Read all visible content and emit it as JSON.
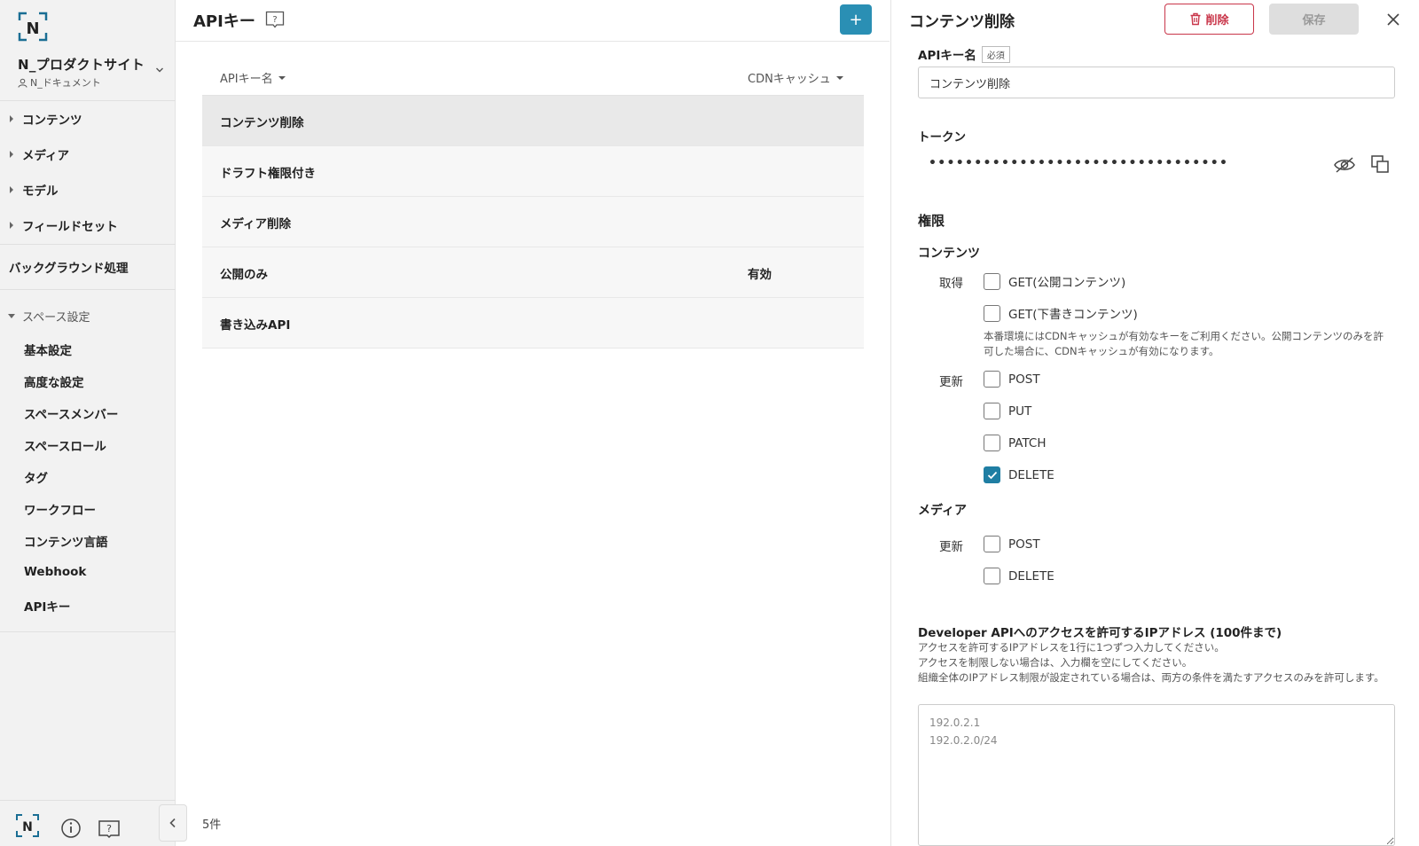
{
  "sidebar": {
    "space_name": "N_プロダクトサイト",
    "space_sub": "N_ドキュメント",
    "nav": [
      {
        "label": "コンテンツ"
      },
      {
        "label": "メディア"
      },
      {
        "label": "モデル"
      },
      {
        "label": "フィールドセット"
      }
    ],
    "background_label": "バックグラウンド処理",
    "space_settings_label": "スペース設定",
    "settings_items": [
      {
        "label": "基本設定"
      },
      {
        "label": "高度な設定"
      },
      {
        "label": "スペースメンバー"
      },
      {
        "label": "スペースロール"
      },
      {
        "label": "タグ"
      },
      {
        "label": "ワークフロー"
      },
      {
        "label": "コンテンツ言語"
      },
      {
        "label": "Webhook"
      },
      {
        "label": "APIキー"
      }
    ],
    "logo_text": "N"
  },
  "main": {
    "title": "APIキー",
    "add_label": "+",
    "columns": {
      "name": "APIキー名",
      "cdn": "CDNキャッシュ"
    },
    "rows": [
      {
        "name": "コンテンツ削除",
        "cdn": ""
      },
      {
        "name": "ドラフト権限付き",
        "cdn": ""
      },
      {
        "name": "メディア削除",
        "cdn": ""
      },
      {
        "name": "公開のみ",
        "cdn": "有効"
      },
      {
        "name": "書き込みAPI",
        "cdn": ""
      }
    ],
    "count": "5件"
  },
  "panel": {
    "title": "コンテンツ削除",
    "delete_label": "削除",
    "save_label": "保存",
    "name_label": "APIキー名",
    "required_label": "必須",
    "name_value": "コンテンツ削除",
    "token_label": "トークン",
    "token_mask": "•••••••••••••••••••••••••••••••••",
    "permissions_title": "権限",
    "content_group": "コンテンツ",
    "get_label": "取得",
    "update_label": "更新",
    "get_public": "GET(公開コンテンツ)",
    "get_draft": "GET(下書きコンテンツ)",
    "cdn_note": "本番環境にはCDNキャッシュが有効なキーをご利用ください。公開コンテンツのみを許可した場合に、CDNキャッシュが有効になります。",
    "post": "POST",
    "put": "PUT",
    "patch": "PATCH",
    "delete": "DELETE",
    "media_group": "メディア",
    "media_update_label": "更新",
    "media_post": "POST",
    "media_delete": "DELETE",
    "ip_label": "Developer APIへのアクセスを許可するIPアドレス (100件まで)",
    "ip_desc": [
      "アクセスを許可するIPアドレスを1行に1つずつ入力してください。",
      "アクセスを制限しない場合は、入力欄を空にしてください。",
      "組織全体のIPアドレス制限が設定されている場合は、両方の条件を満たすアクセスのみを許可します。"
    ],
    "ip_placeholder": "192.0.2.1\n192.0.2.0/24",
    "checked": {
      "get_public": false,
      "get_draft": false,
      "post": false,
      "put": false,
      "patch": false,
      "delete": true,
      "media_post": false,
      "media_delete": false
    }
  },
  "colors": {
    "accent": "#2a8fb4",
    "danger": "#c9364a",
    "checked": "#1f7ea3"
  }
}
